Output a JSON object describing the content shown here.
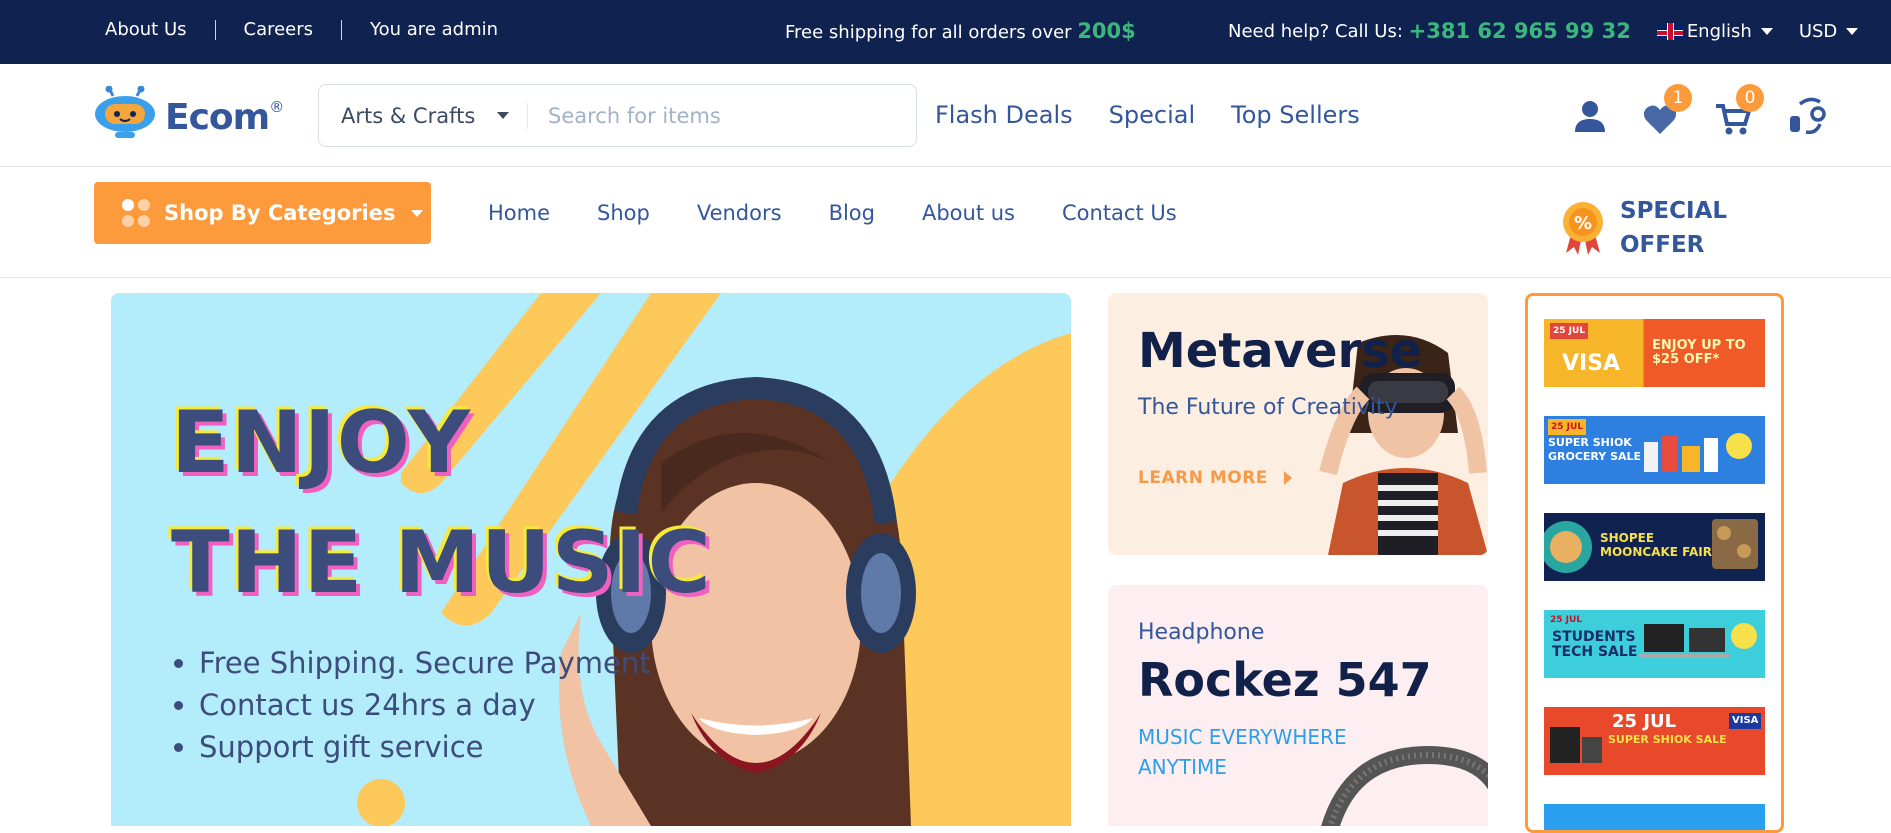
{
  "topbar": {
    "about": "About Us",
    "careers": "Careers",
    "admin": "You are admin",
    "shipping_text": "Free shipping for all orders over",
    "shipping_amount": "200$",
    "help_text": "Need help? Call Us:",
    "phone": "+381 62 965 99 32",
    "language": "English",
    "currency": "USD"
  },
  "header": {
    "brand": "Ecom",
    "registered": "®",
    "search_category": "Arts & Crafts",
    "search_placeholder": "Search for items",
    "links": [
      "Flash Deals",
      "Special",
      "Top Sellers"
    ],
    "wishlist_count": "1",
    "cart_count": "0"
  },
  "nav": {
    "categories_button": "Shop By Categories",
    "links": [
      "Home",
      "Shop",
      "Vendors",
      "Blog",
      "About us",
      "Contact Us"
    ],
    "special_line1": "SPECIAL",
    "special_line2": "OFFER"
  },
  "hero": {
    "title_line1": "ENJOY",
    "title_line2": "THE MUSIC",
    "bullets": [
      "Free Shipping. Secure Payment",
      "Contact us 24hrs a day",
      "Support gift service"
    ]
  },
  "card1": {
    "title": "Metaverse",
    "subtitle": "The Future of Creativity",
    "cta": "LEARN MORE"
  },
  "card2": {
    "kicker": "Headphone",
    "title": "Rockez 547",
    "subtitle": "MUSIC EVERYWHERE ANYTIME"
  },
  "side_banners": [
    {
      "text1": "VISA",
      "text2": "ENJOY UP TO $25 OFF*",
      "date": "25 JUL"
    },
    {
      "text1": "SUPER SHIOK GROCERY SALE",
      "date": "25 JUL"
    },
    {
      "text1": "SHOPEE MOONCAKE FAIR"
    },
    {
      "text1": "STUDENTS TECH SALE",
      "date": "25 JUL"
    },
    {
      "text1": "25 JUL",
      "text2": "SUPER SHIOK SALE",
      "tag": "VISA"
    },
    {
      "text1": ""
    }
  ],
  "colors": {
    "topbar_bg": "#0f2250",
    "accent_orange": "#fd9a3c",
    "accent_green": "#3bb77e",
    "brand_blue": "#34569b",
    "hero_bg": "#b3ecfa"
  }
}
